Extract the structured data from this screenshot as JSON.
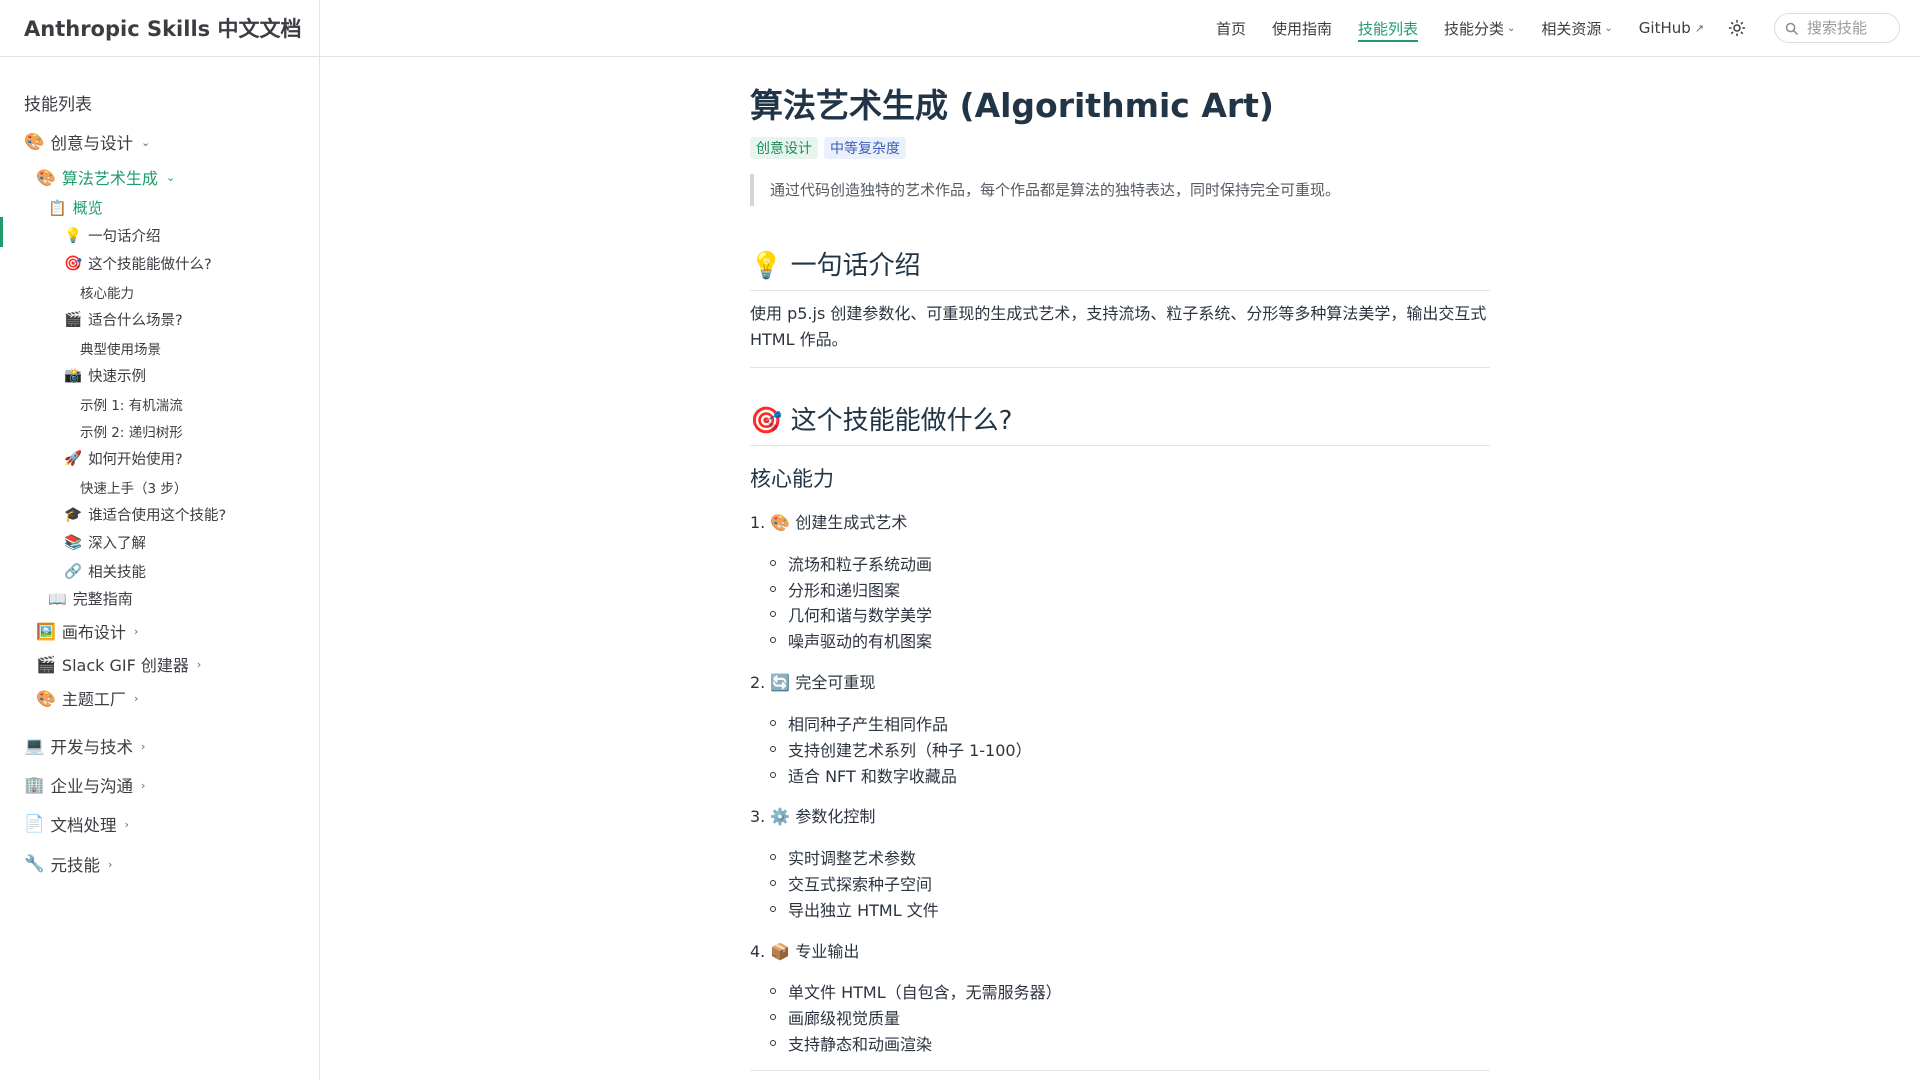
{
  "navbar": {
    "title": "Anthropic Skills 中文文档",
    "links": {
      "home": "首页",
      "guide": "使用指南",
      "skills": "技能列表",
      "categories": "技能分类",
      "resources": "相关资源",
      "github": "GitHub"
    },
    "search_placeholder": "搜索技能"
  },
  "sidebar": {
    "title": "技能列表",
    "items": [
      {
        "emoji": "🎨",
        "label": "创意与设计"
      },
      {
        "emoji": "🎨",
        "label": "算法艺术生成"
      },
      {
        "emoji": "📋",
        "label": "概览"
      },
      {
        "emoji": "💡",
        "label": "一句话介绍"
      },
      {
        "emoji": "🎯",
        "label": "这个技能能做什么?"
      },
      {
        "emoji": "",
        "label": "核心能力"
      },
      {
        "emoji": "🎬",
        "label": "适合什么场景?"
      },
      {
        "emoji": "",
        "label": "典型使用场景"
      },
      {
        "emoji": "📸",
        "label": "快速示例"
      },
      {
        "emoji": "",
        "label": "示例 1: 有机湍流"
      },
      {
        "emoji": "",
        "label": "示例 2: 递归树形"
      },
      {
        "emoji": "🚀",
        "label": "如何开始使用?"
      },
      {
        "emoji": "",
        "label": "快速上手（3 步）"
      },
      {
        "emoji": "🎓",
        "label": "谁适合使用这个技能?"
      },
      {
        "emoji": "📚",
        "label": "深入了解"
      },
      {
        "emoji": "🔗",
        "label": "相关技能"
      },
      {
        "emoji": "📖",
        "label": "完整指南"
      },
      {
        "emoji": "🖼️",
        "label": "画布设计"
      },
      {
        "emoji": "🎬",
        "label": "Slack GIF 创建器"
      },
      {
        "emoji": "🎨",
        "label": "主题工厂"
      },
      {
        "emoji": "💻",
        "label": "开发与技术"
      },
      {
        "emoji": "🏢",
        "label": "企业与沟通"
      },
      {
        "emoji": "📄",
        "label": "文档处理"
      },
      {
        "emoji": "🔧",
        "label": "元技能"
      }
    ]
  },
  "main": {
    "title": "算法艺术生成 (Algorithmic Art)",
    "badges": [
      "创意设计",
      "中等复杂度"
    ],
    "quote": "通过代码创造独特的艺术作品，每个作品都是算法的独特表达，同时保持完全可重现。",
    "sec1": {
      "emoji": "💡",
      "title": "一句话介绍"
    },
    "intro": "使用 p5.js 创建参数化、可重现的生成式艺术，支持流场、粒子系统、分形等多种算法美学，输出交互式 HTML 作品。",
    "sec2": {
      "emoji": "🎯",
      "title": "这个技能能做什么?"
    },
    "core_heading": "核心能力",
    "capabilities": [
      {
        "num": "1.",
        "emoji": "🎨",
        "title": "创建生成式艺术",
        "points": [
          "流场和粒子系统动画",
          "分形和递归图案",
          "几何和谐与数学美学",
          "噪声驱动的有机图案"
        ]
      },
      {
        "num": "2.",
        "emoji": "🔄",
        "title": "完全可重现",
        "points": [
          "相同种子产生相同作品",
          "支持创建艺术系列（种子 1-100）",
          "适合 NFT 和数字收藏品"
        ]
      },
      {
        "num": "3.",
        "emoji": "⚙️",
        "title": "参数化控制",
        "points": [
          "实时调整艺术参数",
          "交互式探索种子空间",
          "导出独立 HTML 文件"
        ]
      },
      {
        "num": "4.",
        "emoji": "📦",
        "title": "专业输出",
        "points": [
          "单文件 HTML（自包含，无需服务器）",
          "画廊级视觉质量",
          "支持静态和动画渲染"
        ]
      }
    ]
  }
}
